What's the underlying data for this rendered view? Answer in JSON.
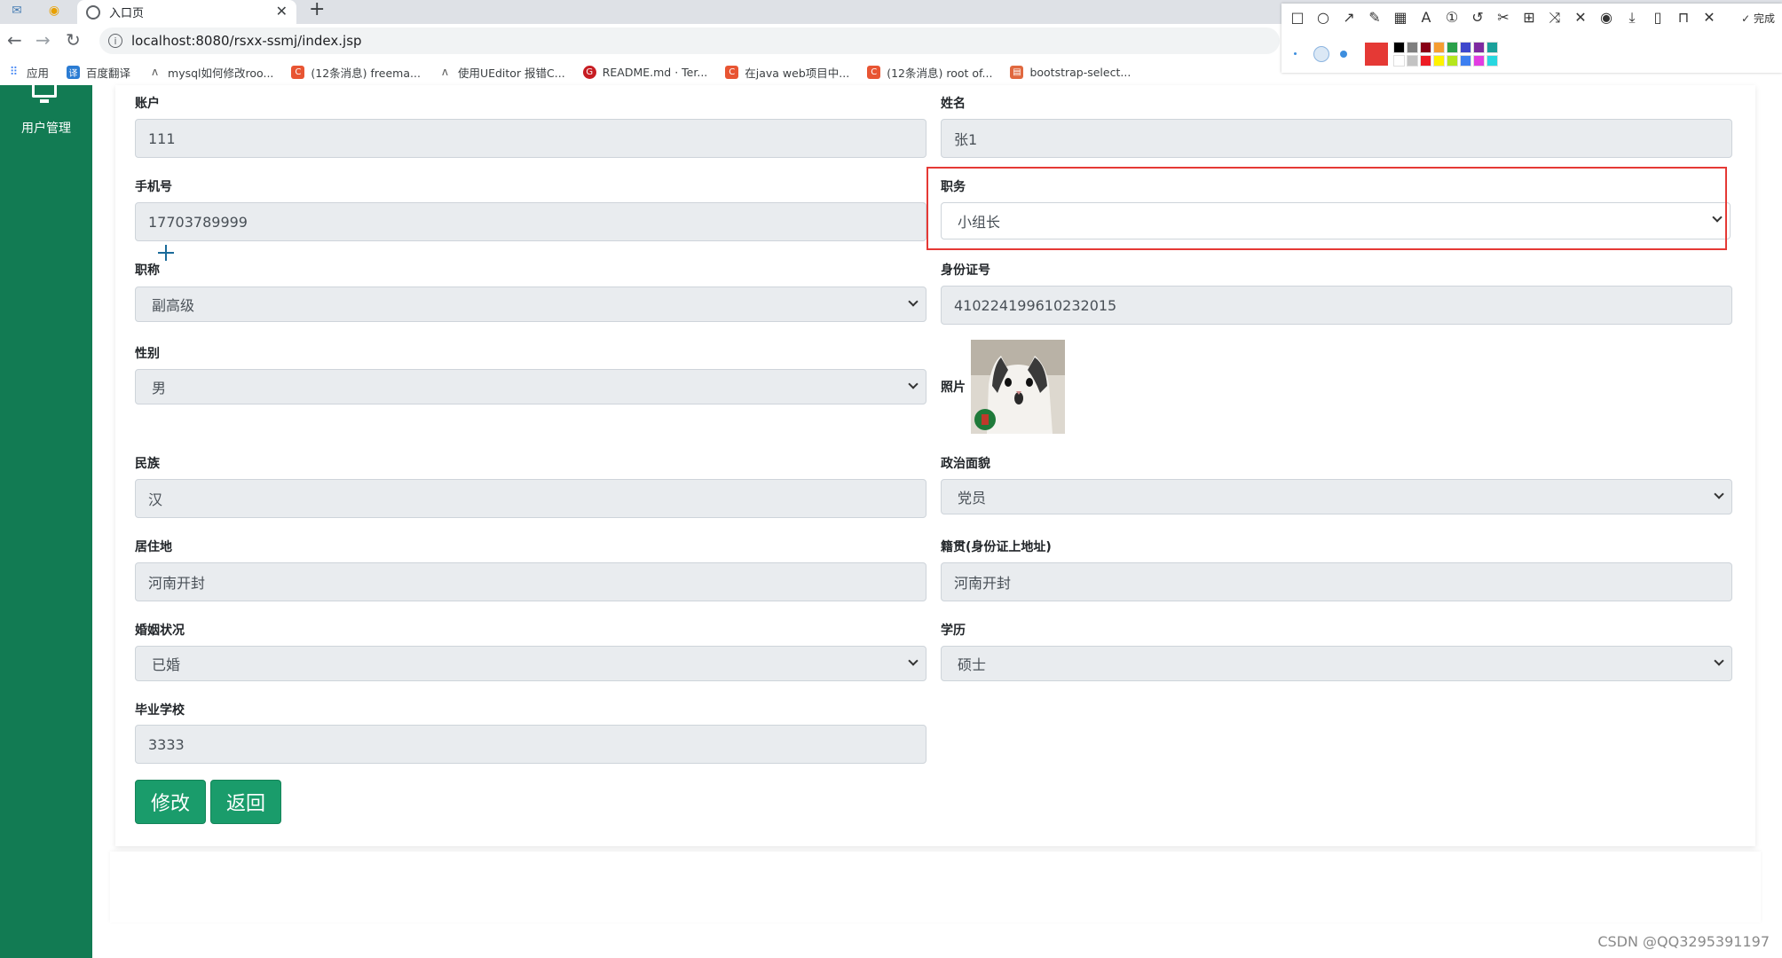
{
  "browser": {
    "tab_title": "入口页",
    "url": "localhost:8080/rsxx-ssmj/index.jsp",
    "bookmarks": [
      {
        "label": "应用",
        "icon": "apps-grid-icon",
        "color": "#4285f4"
      },
      {
        "label": "百度翻译",
        "icon": "baidu-translate-icon",
        "color": "#2b7cd3"
      },
      {
        "label": "mysql如何修改roo...",
        "icon": "bookmark-icon",
        "color": "#666666"
      },
      {
        "label": "(12条消息) freema...",
        "icon": "csdn-icon",
        "color": "#e85533"
      },
      {
        "label": "使用UEditor 报错C...",
        "icon": "bookmark-icon",
        "color": "#666666"
      },
      {
        "label": "README.md · Ter...",
        "icon": "gitee-icon",
        "color": "#c71d23"
      },
      {
        "label": "在java web项目中...",
        "icon": "csdn-icon",
        "color": "#e85533"
      },
      {
        "label": "(12条消息) root of...",
        "icon": "csdn-icon",
        "color": "#e85533"
      },
      {
        "label": "bootstrap-select...",
        "icon": "bookmark-icon",
        "color": "#e0683f"
      }
    ],
    "snap_done_label": "完成"
  },
  "sidebar": {
    "label": "用户管理",
    "color": "#127b53"
  },
  "form": {
    "account": {
      "label": "账户",
      "value": "111"
    },
    "name": {
      "label": "姓名",
      "value": "张1"
    },
    "phone": {
      "label": "手机号",
      "value": "17703789999"
    },
    "position": {
      "label": "职务",
      "value": "小组长"
    },
    "title": {
      "label": "职称",
      "value": "副高级"
    },
    "id_number": {
      "label": "身份证号",
      "value": "410224199610232015"
    },
    "gender": {
      "label": "性别",
      "value": "男"
    },
    "photo": {
      "label": "照片"
    },
    "ethnicity": {
      "label": "民族",
      "value": "汉"
    },
    "political": {
      "label": "政治面貌",
      "value": "党员"
    },
    "residence": {
      "label": "居住地",
      "value": "河南开封"
    },
    "native_place": {
      "label": "籍贯(身份证上地址)",
      "value": "河南开封"
    },
    "marital": {
      "label": "婚姻状况",
      "value": "已婚"
    },
    "education": {
      "label": "学历",
      "value": "硕士"
    },
    "school": {
      "label": "毕业学校",
      "value": "3333"
    }
  },
  "buttons": {
    "modify": "修改",
    "back": "返回"
  },
  "accent_color": "#1a9c6b",
  "highlight_color": "#e53935",
  "watermark": "CSDN @QQ3295391197"
}
